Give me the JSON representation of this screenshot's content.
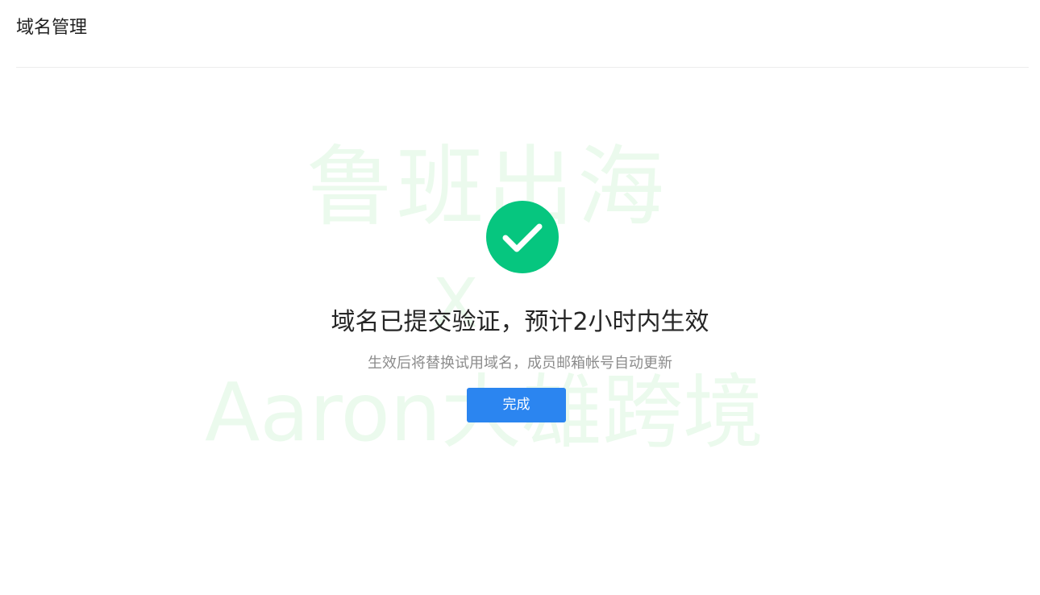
{
  "header": {
    "title": "域名管理"
  },
  "watermark": {
    "line1": "鲁班出海",
    "line2": "X",
    "line3": "Aaron大雄跨境"
  },
  "result": {
    "status": "success",
    "icon": "check-circle-icon",
    "icon_color": "#06c67f",
    "title": "域名已提交验证，预计2小时内生效",
    "subtitle": "生效后将替换试用域名，成员邮箱帐号自动更新",
    "done_label": "完成",
    "button_color": "#2b85f0"
  }
}
